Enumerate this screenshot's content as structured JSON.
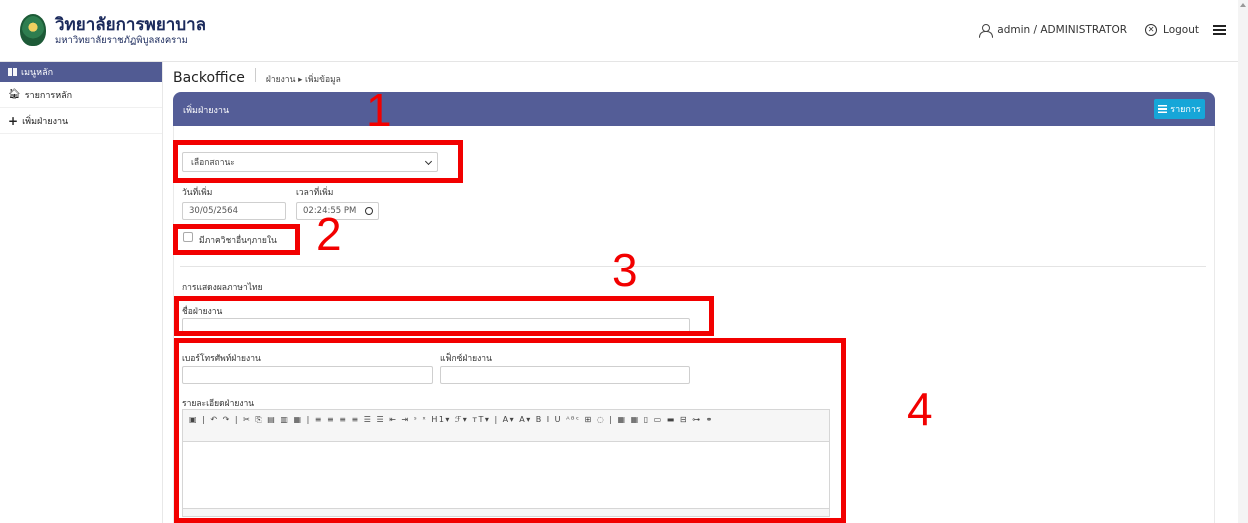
{
  "header": {
    "org_name": "วิทยาลัยการพยาบาล",
    "org_sub": "มหาวิทยาลัยราชภัฏพิบูลสงคราม",
    "user_label": "admin / ADMINISTRATOR",
    "logout_label": "Logout"
  },
  "sidebar": {
    "section_label": "เมนูหลัก",
    "items": [
      {
        "label": "รายการหลัก"
      },
      {
        "label": "เพิ่มฝ่ายงาน"
      }
    ]
  },
  "breadcrumb": {
    "title": "Backoffice",
    "path": "ฝ่ายงาน ▸ เพิ่มข้อมูล"
  },
  "panel": {
    "title": "เพิ่มฝ่ายงาน",
    "list_button": "รายการ"
  },
  "form": {
    "status_select": "เลือกสถานะ",
    "date_label": "วันที่เพิ่ม",
    "date_value": "30/05/2564",
    "time_label": "เวลาที่เพิ่ม",
    "time_value": "02:24:55 PM",
    "internal_checkbox_label": "มีภาควิชาอื่นๆภายใน",
    "section_thai": "การแสดงผลภาษาไทย",
    "name_label": "ชื่อฝ่ายงาน",
    "phone_label": "เบอร์โทรศัพท์ฝ่ายงาน",
    "fax_label": "แฟ็กซ์ฝ่ายงาน",
    "detail_label": "รายละเอียดฝ่ายงาน",
    "toolbar_glyphs": "▣ | ↶ ↷ | ✂ ⎘ ▤ ▥ ▦ | ≡ ≡ ≡ ≡ ☰ ☰ ⇤ ⇥ ˢ ˣ H1▾ ℱ▾ ᴛT▾ | A▾ A▾ B I U ᴬᴮᶜ ⊞ ◌ | ▦ ▦ ▯ ▭ ▬ ⊟ ⊶ ⚭"
  },
  "annotations": [
    "1",
    "2",
    "3",
    "4"
  ],
  "colors": {
    "panel_header": "#545d97",
    "sidebar_header": "#515b93",
    "list_button": "#16a6d8",
    "annotation": "#f20000"
  }
}
